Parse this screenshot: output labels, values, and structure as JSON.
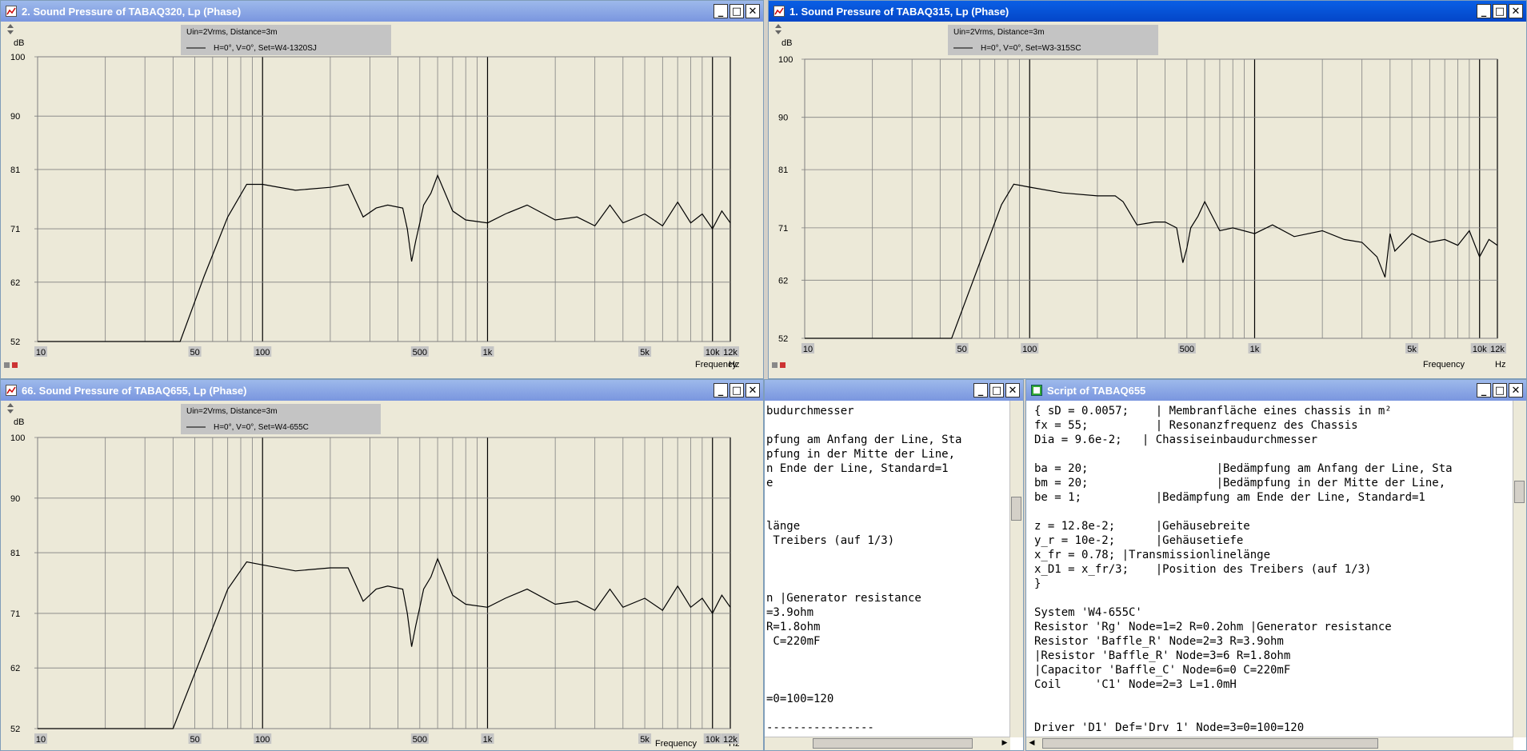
{
  "plots": [
    {
      "title": "2. Sound Pressure of TABAQ320, Lp (Phase)",
      "legend_line1": "Uin=2Vrms, Distance=3m",
      "legend_line2": "H=0°, V=0°, Set=W4-1320SJ",
      "active": false
    },
    {
      "title": "1. Sound Pressure of TABAQ315, Lp (Phase)",
      "legend_line1": "Uin=2Vrms, Distance=3m",
      "legend_line2": "H=0°, V=0°, Set=W3-315SC",
      "active": true
    },
    {
      "title": "66. Sound Pressure of TABAQ655, Lp (Phase)",
      "legend_line1": "Uin=2Vrms, Distance=3m",
      "legend_line2": "H=0°, V=0°, Set=W4-655C",
      "active": false
    }
  ],
  "axis": {
    "y_unit": "dB",
    "x_unit": "Hz",
    "x_title": "Frequency",
    "y_ticks": [
      "100",
      "90",
      "81",
      "71",
      "62",
      "52"
    ],
    "x_ticks": [
      "10",
      "50",
      "100",
      "500",
      "1k",
      "5k",
      "10k",
      "12k"
    ]
  },
  "chart_data": [
    {
      "type": "line",
      "xscale": "log",
      "xlim": [
        10,
        12000
      ],
      "ylim": [
        52,
        100
      ],
      "xlabel": "Frequency",
      "ylabel": "dB",
      "x": [
        10,
        43,
        55,
        70,
        85,
        100,
        140,
        200,
        240,
        280,
        320,
        360,
        420,
        440,
        460,
        480,
        500,
        520,
        560,
        600,
        700,
        800,
        1000,
        1200,
        1500,
        2000,
        2500,
        3000,
        3500,
        4000,
        5000,
        6000,
        7000,
        8000,
        9000,
        10000,
        11000,
        12000
      ],
      "y": [
        52,
        52,
        63,
        73,
        78.5,
        78.5,
        77.5,
        78,
        78.5,
        73,
        74.5,
        75,
        74.5,
        71,
        65.5,
        69,
        72,
        75,
        77,
        80,
        74,
        72.5,
        72,
        73.5,
        75,
        72.5,
        73,
        71.5,
        75,
        72,
        73.5,
        71.5,
        75.5,
        72,
        73.5,
        71,
        74,
        72
      ]
    },
    {
      "type": "line",
      "xscale": "log",
      "xlim": [
        10,
        12000
      ],
      "ylim": [
        52,
        100
      ],
      "xlabel": "Frequency",
      "ylabel": "dB",
      "x": [
        10,
        45,
        60,
        75,
        85,
        100,
        140,
        200,
        240,
        260,
        300,
        360,
        400,
        450,
        480,
        500,
        520,
        560,
        600,
        700,
        800,
        1000,
        1200,
        1500,
        2000,
        2500,
        3000,
        3500,
        3800,
        4000,
        4200,
        5000,
        6000,
        7000,
        8000,
        9000,
        10000,
        11000,
        12000
      ],
      "y": [
        52,
        52,
        65,
        75,
        78.5,
        78,
        77,
        76.5,
        76.5,
        75.5,
        71.5,
        72,
        72,
        71,
        65,
        67.5,
        71,
        73,
        75.5,
        70.5,
        71,
        70,
        71.5,
        69.5,
        70.5,
        69,
        68.5,
        66,
        62.5,
        70,
        67,
        70,
        68.5,
        69,
        68,
        70.5,
        66,
        69,
        68
      ]
    },
    {
      "type": "line",
      "xscale": "log",
      "xlim": [
        10,
        12000
      ],
      "ylim": [
        52,
        100
      ],
      "xlabel": "Frequency",
      "ylabel": "dB",
      "x": [
        10,
        40,
        55,
        70,
        85,
        100,
        140,
        200,
        240,
        280,
        320,
        360,
        420,
        440,
        460,
        480,
        500,
        520,
        560,
        600,
        700,
        800,
        1000,
        1200,
        1500,
        2000,
        2500,
        3000,
        3500,
        4000,
        5000,
        6000,
        7000,
        8000,
        9000,
        10000,
        11000,
        12000
      ],
      "y": [
        52,
        52,
        65,
        75,
        79.5,
        79,
        78,
        78.5,
        78.5,
        73,
        75,
        75.5,
        75,
        71,
        65.5,
        69,
        72,
        75,
        77,
        80,
        74,
        72.5,
        72,
        73.5,
        75,
        72.5,
        73,
        71.5,
        75,
        72,
        73.5,
        71.5,
        75.5,
        72,
        73.5,
        71,
        74,
        72
      ]
    }
  ],
  "scripts": [
    {
      "title": "",
      "lines": [
        "budurchmesser",
        "",
        "pfung am Anfang der Line, Sta",
        "pfung in der Mitte der Line,",
        "n Ende der Line, Standard=1",
        "e",
        "",
        "",
        "länge",
        " Treibers (auf 1/3)",
        "",
        "",
        "",
        "n |Generator resistance",
        "=3.9ohm",
        "R=1.8ohm",
        " C=220mF",
        "",
        "",
        "",
        "=0=100=120",
        "",
        "----------------"
      ]
    },
    {
      "title": "Script of TABAQ655",
      "lines": [
        "{ sD = 0.0057;    | Membranfläche eines chassis in m²",
        "fx = 55;          | Resonanzfrequenz des Chassis",
        "Dia = 9.6e-2;   | Chassiseinbaudurchmesser",
        "",
        "ba = 20;                   |Bedämpfung am Anfang der Line, Sta",
        "bm = 20;                   |Bedämpfung in der Mitte der Line,",
        "be = 1;           |Bedämpfung am Ende der Line, Standard=1",
        "",
        "z = 12.8e-2;      |Gehäusebreite",
        "y_r = 10e-2;      |Gehäusetiefe",
        "x_fr = 0.78; |Transmissionlinelänge",
        "x_D1 = x_fr/3;    |Position des Treibers (auf 1/3)",
        "}",
        "",
        "System 'W4-655C'",
        "Resistor 'Rg' Node=1=2 R=0.2ohm |Generator resistance",
        "Resistor 'Baffle_R' Node=2=3 R=3.9ohm",
        "|Resistor 'Baffle_R' Node=3=6 R=1.8ohm",
        "|Capacitor 'Baffle_C' Node=6=0 C=220mF",
        "Coil     'C1' Node=2=3 L=1.0mH",
        "",
        "",
        "Driver 'D1' Def='Drv 1' Node=3=0=100=120"
      ]
    }
  ],
  "window_controls": {
    "minimize": "_",
    "maximize": "□",
    "close": "✕"
  },
  "colors": {
    "active_title": "#0346c8",
    "inactive_title": "#7a96df",
    "plot_background": "#ece9d8",
    "grid": "#808080",
    "legend_box": "#c4c4c4"
  }
}
